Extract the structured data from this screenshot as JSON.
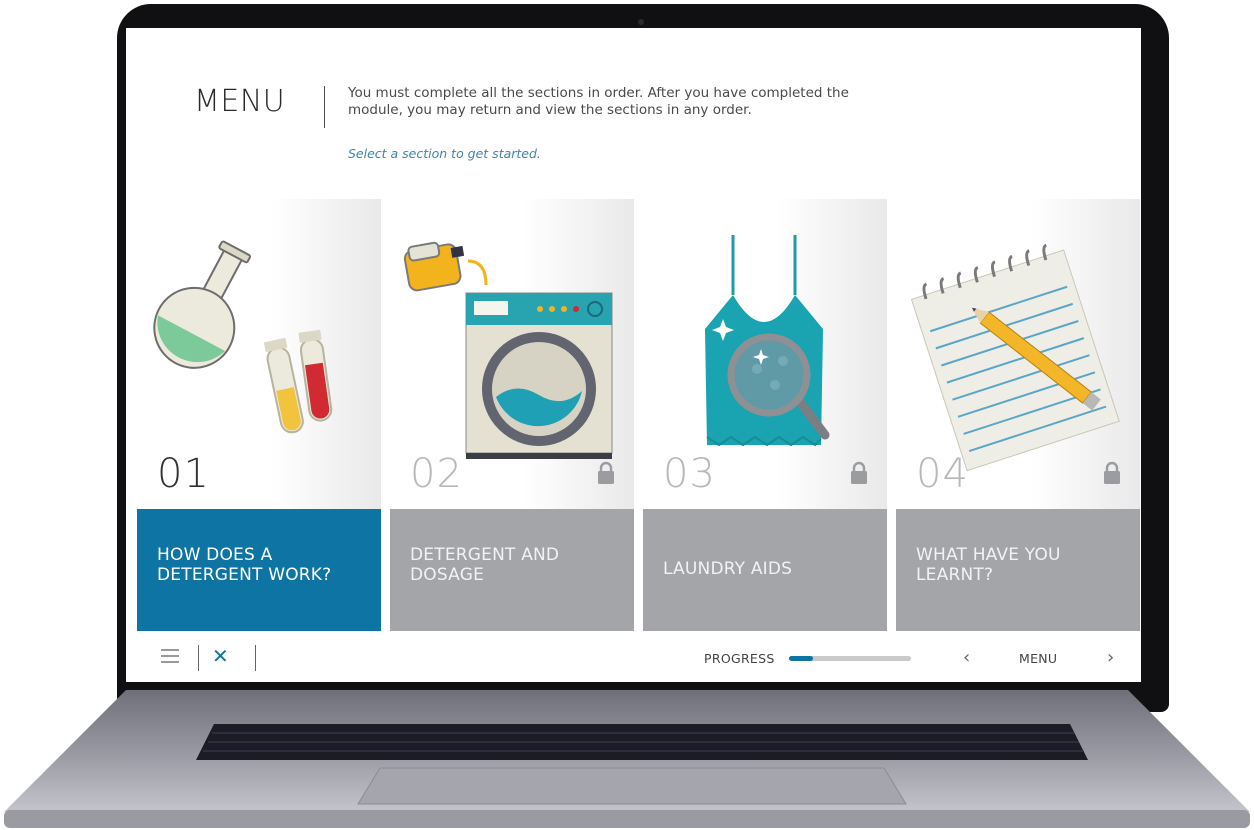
{
  "header": {
    "title": "MENU",
    "instructions": "You must complete all the sections in order. After you have completed the module, you may return and view the sections in any order.",
    "hint": "Select a section to get started."
  },
  "cards": [
    {
      "number": "01",
      "label": "HOW DOES A DETERGENT WORK?",
      "state": "active",
      "icon": "lab-flask-icon"
    },
    {
      "number": "02",
      "label": "DETERGENT AND DOSAGE",
      "state": "locked",
      "icon": "washing-machine-icon"
    },
    {
      "number": "03",
      "label": "LAUNDRY AIDS",
      "state": "locked",
      "icon": "garment-magnifier-icon"
    },
    {
      "number": "04",
      "label": "WHAT HAVE YOU LEARNT?",
      "state": "locked",
      "icon": "notepad-pencil-icon"
    }
  ],
  "footer": {
    "progress_label": "PROGRESS",
    "progress_fraction": 0.2,
    "menu_label": "MENU",
    "prev_glyph": "‹",
    "next_glyph": "›",
    "close_glyph": "✕"
  },
  "colors": {
    "accent": "#0e74a3",
    "locked_tile": "#a3a5a8",
    "hint_text": "#3f86a6"
  }
}
